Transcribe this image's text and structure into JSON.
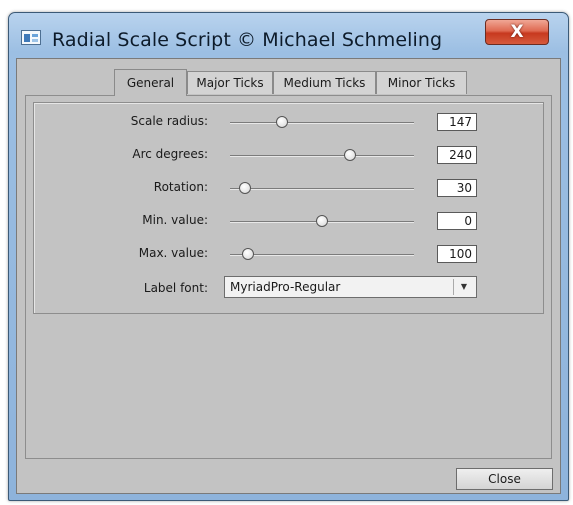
{
  "window": {
    "title": "Radial Scale Script © Michael Schmeling",
    "close_glyph": "X"
  },
  "tabs": [
    {
      "label": "General",
      "active": true
    },
    {
      "label": "Major Ticks",
      "active": false
    },
    {
      "label": "Medium Ticks",
      "active": false
    },
    {
      "label": "Minor Ticks",
      "active": false
    }
  ],
  "general": {
    "scale_radius": {
      "label": "Scale radius:",
      "value": "147",
      "slider_fraction": 0.28
    },
    "arc_degrees": {
      "label": "Arc degrees:",
      "value": "240",
      "slider_fraction": 0.65
    },
    "rotation": {
      "label": "Rotation:",
      "value": "30",
      "slider_fraction": 0.08
    },
    "min_value": {
      "label": "Min. value:",
      "value": "0",
      "slider_fraction": 0.5
    },
    "max_value": {
      "label": "Max. value:",
      "value": "100",
      "slider_fraction": 0.1
    },
    "label_font": {
      "label": "Label font:",
      "value": "MyriadPro-Regular",
      "arrow_glyph": "▼"
    }
  },
  "footer": {
    "close_label": "Close"
  },
  "icons": {
    "app_icon": "window-app-icon",
    "dropdown_icon": "chevron-down-icon"
  }
}
